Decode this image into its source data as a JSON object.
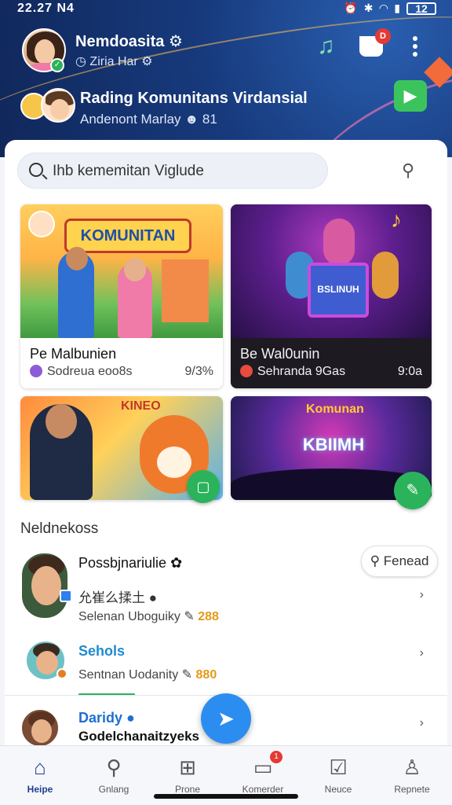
{
  "status_bar": {
    "time": "22.27 N4",
    "battery": "12"
  },
  "profile": {
    "name": "Nemdoasita",
    "subtitle": "Ziria Har"
  },
  "community": {
    "title": "Rading Komunitans Virdansial",
    "subtitle": "Andenont Marlay",
    "count": "81"
  },
  "header_icons": {
    "cart_badge": "D"
  },
  "search": {
    "text": "Ihb kememitan Viglude"
  },
  "cards": [
    {
      "banner": "KOMUNITAN",
      "title": "Pe Malbunien",
      "subtitle": "Sodreua eoo8s",
      "stat": "9/3%"
    },
    {
      "screen": "BSLINUH",
      "title": "Be Wal0unin",
      "subtitle": "Sehranda 9Gas",
      "stat": "9:0a"
    },
    {
      "word": "KINEO"
    },
    {
      "word": "Komunan",
      "sign": "KBIIMH"
    }
  ],
  "section": {
    "title": "Neldnekoss"
  },
  "list": [
    {
      "name": "Possbjnariulie",
      "line2": "允崔么揉土",
      "line3_prefix": "Selenan Uboguiky",
      "number": "288",
      "action": "Fenead"
    },
    {
      "name": "Sehols",
      "line3_prefix": "Sentnan Uodanity",
      "number": "880"
    },
    {
      "name": "Daridy",
      "line2": "Godelchanaitzyeks"
    }
  ],
  "bottom_nav": [
    {
      "label": "Heipe",
      "icon": "home-icon",
      "active": true
    },
    {
      "label": "Gnlang",
      "icon": "search-icon"
    },
    {
      "label": "Prone",
      "icon": "add-icon"
    },
    {
      "label": "Komerder",
      "icon": "chat-icon",
      "badge": "1"
    },
    {
      "label": "Neuce",
      "icon": "checklist-icon"
    },
    {
      "label": "Repnete",
      "icon": "profile-icon"
    }
  ],
  "colors": {
    "header": "#173a7d",
    "accent_green": "#2bb35c",
    "accent_blue": "#2c8df0",
    "badge_red": "#e53935",
    "number_orange": "#e39b18"
  }
}
